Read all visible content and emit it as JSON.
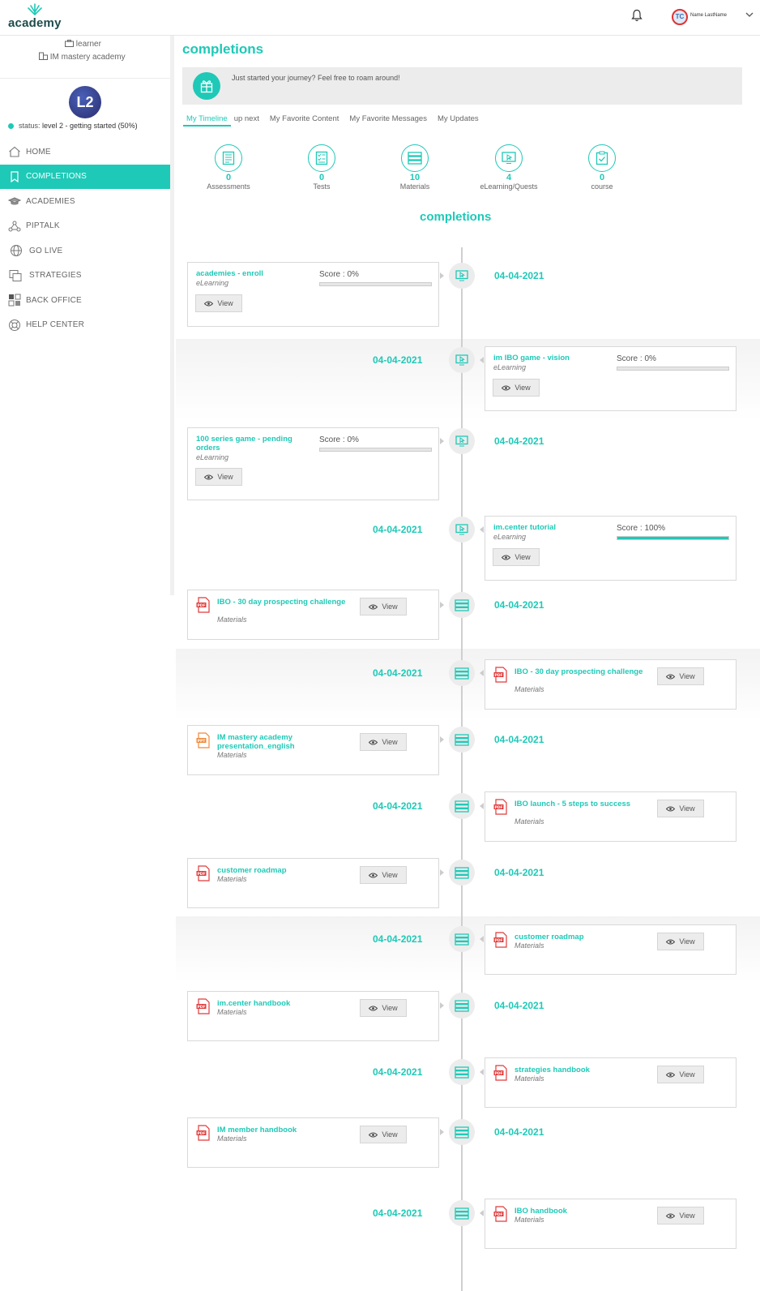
{
  "header": {
    "logo_text": "academy",
    "user_initials": "TC",
    "user_name": "Name LastName"
  },
  "sidebar": {
    "role": "learner",
    "org": "IM mastery academy",
    "level_badge": "L2",
    "status_prefix": "status:",
    "status_value": "level 2 - getting started (50%)",
    "items": [
      {
        "label": "HOME"
      },
      {
        "label": "COMPLETIONS"
      },
      {
        "label": "ACADEMIES"
      },
      {
        "label": "PIPTALK"
      },
      {
        "label": "GO LIVE"
      },
      {
        "label": "STRATEGIES"
      },
      {
        "label": "BACK OFFICE"
      },
      {
        "label": "HELP CENTER"
      }
    ]
  },
  "main": {
    "page_title": "completions",
    "banner_text": "Just started your journey? Feel free to roam around!",
    "tabs": [
      {
        "label": "My Timeline"
      },
      {
        "label": "up next"
      },
      {
        "label": "My Favorite Content"
      },
      {
        "label": "My Favorite Messages"
      },
      {
        "label": "My Updates"
      }
    ],
    "stats": [
      {
        "count": "0",
        "label": "Assessments"
      },
      {
        "count": "0",
        "label": "Tests"
      },
      {
        "count": "10",
        "label": "Materials"
      },
      {
        "count": "4",
        "label": "eLearning/Quests"
      },
      {
        "count": "0",
        "label": "course"
      }
    ],
    "section_title": "completions",
    "view_label": "View",
    "timeline": [
      {
        "date": "04-04-2021",
        "title": "academies - enroll",
        "type": "eLearning",
        "score": "Score : 0%",
        "progress": 0
      },
      {
        "date": "04-04-2021",
        "title": "im IBO game - vision",
        "type": "eLearning",
        "score": "Score : 0%",
        "progress": 0
      },
      {
        "date": "04-04-2021",
        "title": "100 series game - pending orders",
        "type": "eLearning",
        "score": "Score : 0%",
        "progress": 0
      },
      {
        "date": "04-04-2021",
        "title": "im.center tutorial",
        "type": "eLearning",
        "score": "Score : 100%",
        "progress": 100
      },
      {
        "date": "04-04-2021",
        "title": "IBO - 30 day prospecting challenge",
        "type": "Materials"
      },
      {
        "date": "04-04-2021",
        "title": "IBO - 30 day prospecting challenge",
        "type": "Materials"
      },
      {
        "date": "04-04-2021",
        "title": "IM mastery academy presentation_english",
        "type": "Materials"
      },
      {
        "date": "04-04-2021",
        "title": "IBO launch - 5 steps to success",
        "type": "Materials"
      },
      {
        "date": "04-04-2021",
        "title": "customer roadmap",
        "type": "Materials"
      },
      {
        "date": "04-04-2021",
        "title": "customer roadmap",
        "type": "Materials"
      },
      {
        "date": "04-04-2021",
        "title": "im.center handbook",
        "type": "Materials"
      },
      {
        "date": "04-04-2021",
        "title": "strategies handbook",
        "type": "Materials"
      },
      {
        "date": "04-04-2021",
        "title": "IM member handbook",
        "type": "Materials"
      },
      {
        "date": "04-04-2021",
        "title": "IBO handbook",
        "type": "Materials"
      }
    ]
  },
  "colors": {
    "accent": "#1ec9b7",
    "pdf_red": "#e03b3b",
    "ppt_orange": "#f0883a"
  }
}
